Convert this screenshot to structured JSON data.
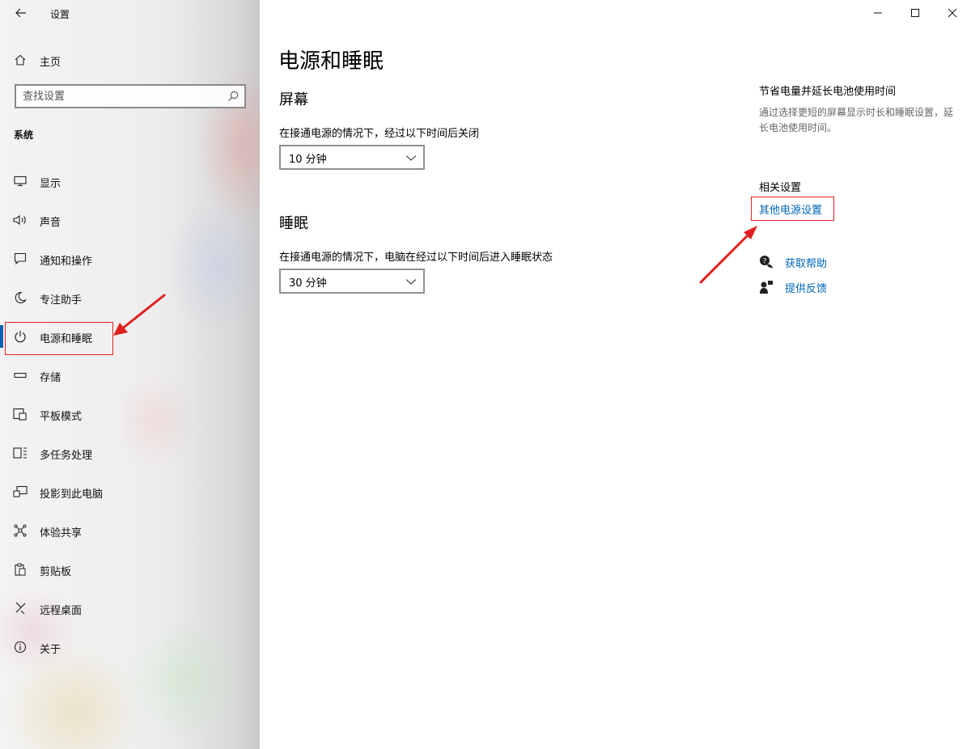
{
  "app": {
    "title": "设置"
  },
  "sidebar": {
    "home_label": "主页",
    "search": {
      "placeholder": "查找设置",
      "value": ""
    },
    "section_label": "系统",
    "items": [
      {
        "label": "显示",
        "icon": "display-icon"
      },
      {
        "label": "声音",
        "icon": "speaker-icon"
      },
      {
        "label": "通知和操作",
        "icon": "notification-icon"
      },
      {
        "label": "专注助手",
        "icon": "moon-icon"
      },
      {
        "label": "电源和睡眠",
        "icon": "power-icon",
        "selected": true
      },
      {
        "label": "存储",
        "icon": "storage-icon"
      },
      {
        "label": "平板模式",
        "icon": "tablet-icon"
      },
      {
        "label": "多任务处理",
        "icon": "multitask-icon"
      },
      {
        "label": "投影到此电脑",
        "icon": "project-icon"
      },
      {
        "label": "体验共享",
        "icon": "share-icon"
      },
      {
        "label": "剪贴板",
        "icon": "clipboard-icon"
      },
      {
        "label": "远程桌面",
        "icon": "remote-desktop-icon"
      },
      {
        "label": "关于",
        "icon": "info-icon"
      }
    ]
  },
  "main": {
    "title": "电源和睡眠",
    "screen": {
      "heading": "屏幕",
      "label": "在接通电源的情况下，经过以下时间后关闭",
      "value": "10 分钟"
    },
    "sleep": {
      "heading": "睡眠",
      "label": "在接通电源的情况下，电脑在经过以下时间后进入睡眠状态",
      "value": "30 分钟"
    }
  },
  "right_panel": {
    "tip_title": "节省电量并延长电池使用时间",
    "tip_desc": "通过选择更短的屏幕显示时长和睡眠设置，延长电池使用时间。",
    "related_title": "相关设置",
    "related_link": "其他电源设置",
    "help_link": "获取帮助",
    "feedback_link": "提供反馈"
  },
  "colors": {
    "accent": "#0063b1",
    "link": "#0067b8",
    "annotation": "#e02020"
  }
}
